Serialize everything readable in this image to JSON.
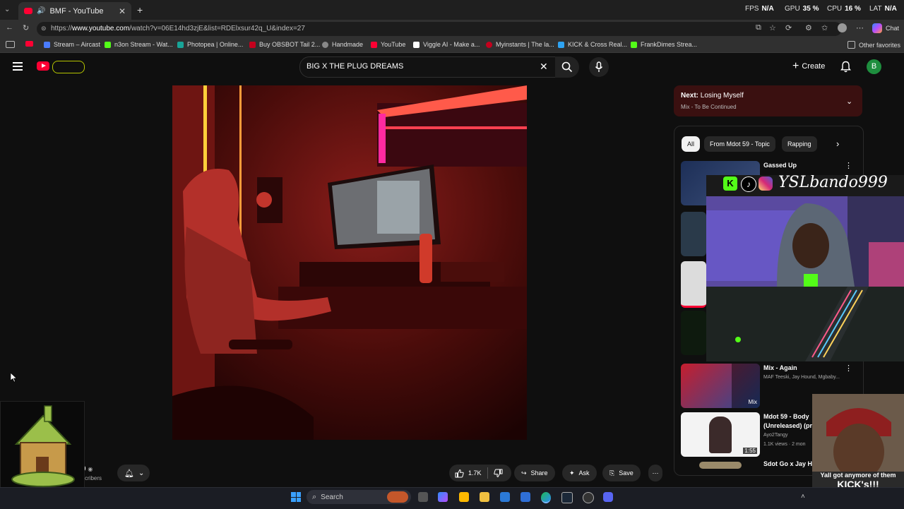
{
  "browser": {
    "tab_title": "BMF - YouTube",
    "url_prefix": "https://",
    "url_host": "www.youtube.com",
    "url_rest": "/watch?v=06E14hd3zjE&list=RDElxsur42q_U&index=27",
    "stats": [
      {
        "label": "FPS",
        "value": "N/A"
      },
      {
        "label": "GPU",
        "value": "35 %"
      },
      {
        "label": "CPU",
        "value": "16 %"
      },
      {
        "label": "LAT",
        "value": "N/A"
      }
    ],
    "chat_label": "Chat"
  },
  "bookmarks": [
    {
      "label": "Stream – Aircast",
      "color": "#4a7cff"
    },
    {
      "label": "n3on Stream - Wat...",
      "color": "#53fc18"
    },
    {
      "label": "Photopea | Online...",
      "color": "#18a497"
    },
    {
      "label": "Buy OBSBOT Tail 2...",
      "color": "#c4001d"
    },
    {
      "label": "Handmade",
      "color": "#888888"
    },
    {
      "label": "YouTube",
      "color": "#ff0033"
    },
    {
      "label": "Viggle AI - Make a...",
      "color": "#ffffff"
    },
    {
      "label": "Myinstants | The la...",
      "color": "#c4001d"
    },
    {
      "label": "KICK & Cross Real...",
      "color": "#2ea3f2"
    },
    {
      "label": "FrankDimes Strea...",
      "color": "#53fc18"
    }
  ],
  "other_favorites": "Other favorites",
  "youtube": {
    "search_value": "BIG X THE PLUG DREAMS",
    "create_label": "Create",
    "avatar_letter": "B"
  },
  "up_next": {
    "prefix": "Next:",
    "title": "Losing Myself",
    "subtitle": "Mix - To Be Continued"
  },
  "chips": [
    "All",
    "From Mdot 59 - Topic",
    "Rapping"
  ],
  "recommendations": [
    {
      "title": "Gassed Up",
      "sub": "",
      "badge": ""
    },
    {
      "title": "Mix - Again",
      "sub": "MAF Teeski, Jay Hound, Mgbaby...",
      "badge": "Mix"
    },
    {
      "title": "Mdot 59 - Body",
      "title2": "(Unreleased) (pr",
      "sub": "Ayo2Tangy",
      "sub2": "1.1K views · 2 mon",
      "badge": "1:55"
    },
    {
      "title": "Sdot Go x Jay He",
      "sub": "",
      "badge": ""
    }
  ],
  "channel": {
    "subs_fragment": "9",
    "subs_label": "scribers"
  },
  "actions": {
    "likes": "1.7K",
    "share": "Share",
    "ask": "Ask",
    "save": "Save"
  },
  "stream_overlay": {
    "handle": "YSLbando999",
    "caption_line1": "Yall got anymore of them",
    "caption_line2": "KICK's!!!"
  },
  "taskbar": {
    "search_placeholder": "Search"
  }
}
